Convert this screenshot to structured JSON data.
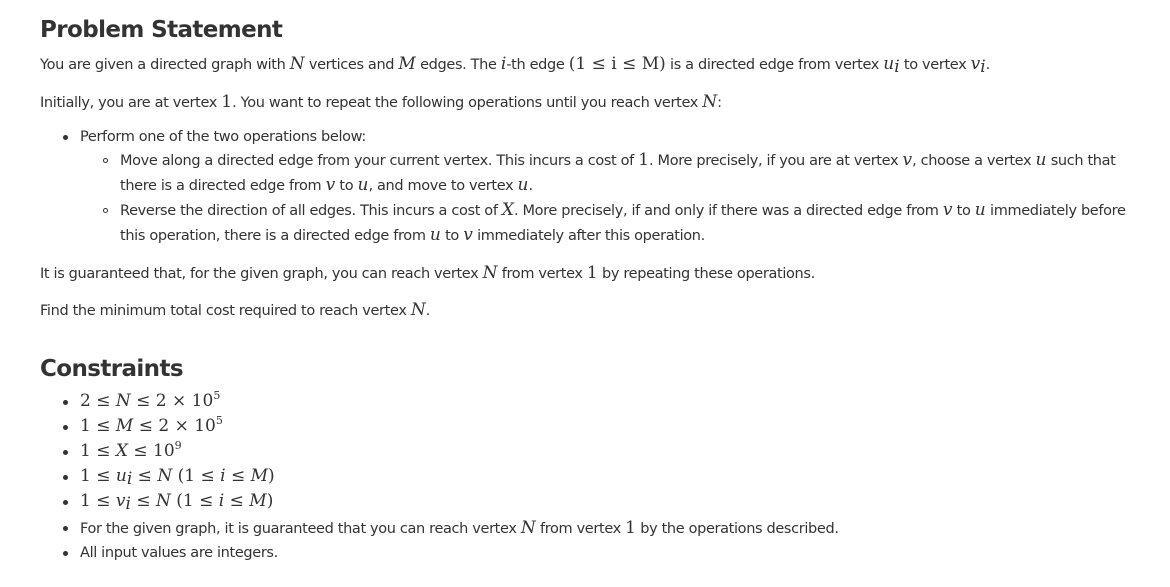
{
  "problem": {
    "heading": "Problem Statement",
    "line1": {
      "t1": "You are given a directed graph with ",
      "N": "N",
      "t2": " vertices and ",
      "M": "M",
      "t3": " edges. The ",
      "i": "i",
      "t4": "-th edge ",
      "range": "(1 ≤ i ≤ M)",
      "t5": " is a directed edge from vertex ",
      "u": "u",
      "u_sub": "i",
      "t6": " to vertex ",
      "v": "v",
      "v_sub": "i",
      "t7": "."
    },
    "line2": {
      "t1": "Initially, you are at vertex ",
      "one": "1",
      "t2": ". You want to repeat the following operations until you reach vertex ",
      "N": "N",
      "t3": ":"
    },
    "bullet1": "Perform one of the two operations below:",
    "op1": {
      "t1": "Move along a directed edge from your current vertex. This incurs a cost of ",
      "one": "1",
      "t2": ". More precisely, if you are at vertex ",
      "v": "v",
      "t3": ", choose a vertex ",
      "u": "u",
      "t4": " such that",
      "c1": "there is a directed edge from ",
      "v2": "v",
      "c2": " to ",
      "u2": "u",
      "c3": ", and move to vertex ",
      "u3": "u",
      "c4": "."
    },
    "op2": {
      "t1": "Reverse the direction of all edges. This incurs a cost of ",
      "X": "X",
      "t2": ". More precisely, if and only if there was a directed edge from ",
      "v": "v",
      "t3": " to ",
      "u": "u",
      "t4": " immediately before",
      "c1": "this operation, there is a directed edge from ",
      "u2": "u",
      "c2": " to ",
      "v2": "v",
      "c3": " immediately after this operation."
    },
    "guarantee": {
      "t1": "It is guaranteed that, for the given graph, you can reach vertex ",
      "N": "N",
      "t2": " from vertex ",
      "one": "1",
      "t3": " by repeating these operations."
    },
    "find": {
      "t1": "Find the minimum total cost required to reach vertex ",
      "N": "N",
      "t2": "."
    }
  },
  "constraints": {
    "heading": "Constraints",
    "c1": {
      "a": "2 ≤ ",
      "N": "N",
      "b": " ≤ 2 × 10",
      "exp": "5"
    },
    "c2": {
      "a": "1 ≤ ",
      "M": "M",
      "b": " ≤ 2 × 10",
      "exp": "5"
    },
    "c3": {
      "a": "1 ≤ ",
      "X": "X",
      "b": " ≤ 10",
      "exp": "9"
    },
    "c4": {
      "a": "1 ≤ ",
      "u": "u",
      "sub": "i",
      "b": " ≤ ",
      "N": "N",
      "c": " (1 ≤ ",
      "i": "i",
      "d": " ≤ ",
      "M": "M",
      "e": ")"
    },
    "c5": {
      "a": "1 ≤ ",
      "v": "v",
      "sub": "i",
      "b": " ≤ ",
      "N": "N",
      "c": " (1 ≤ ",
      "i": "i",
      "d": " ≤ ",
      "M": "M",
      "e": ")"
    },
    "c6": {
      "t1": "For the given graph, it is guaranteed that you can reach vertex ",
      "N": "N",
      "t2": " from vertex ",
      "one": "1",
      "t3": " by the operations described."
    },
    "c7": "All input values are integers."
  }
}
